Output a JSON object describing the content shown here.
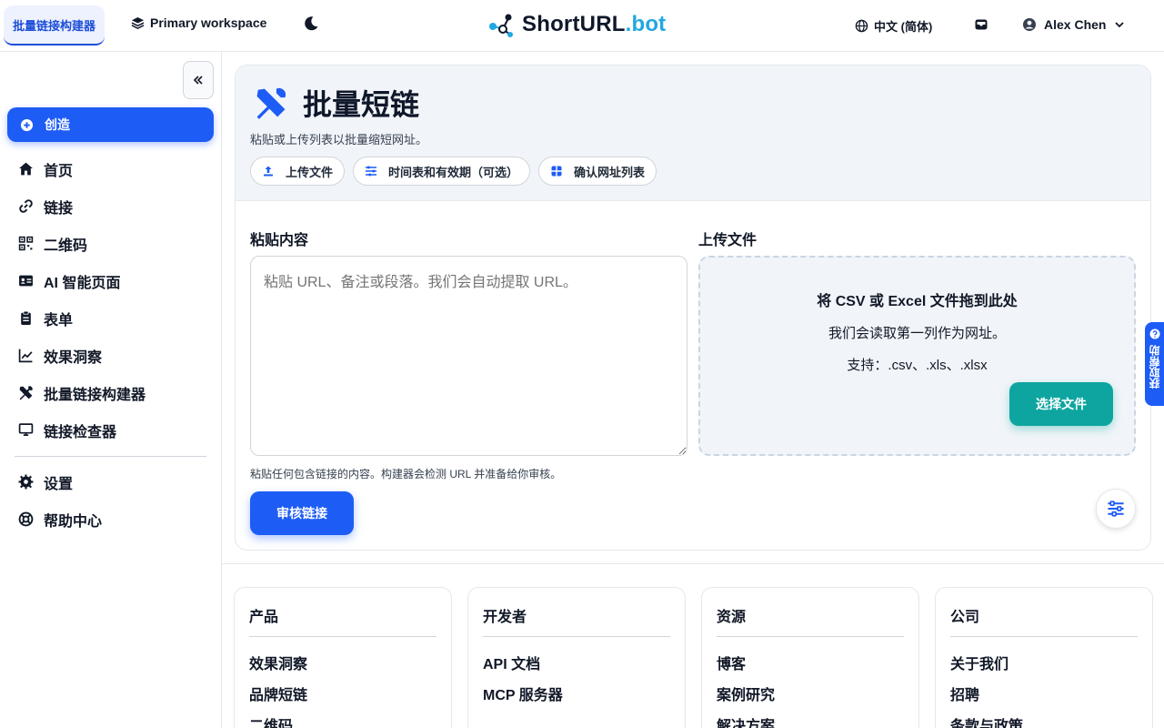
{
  "header": {
    "active_tab": "批量链接构建器",
    "workspace": "Primary workspace",
    "brand_prefix": "ShortURL",
    "brand_suffix": ".bot",
    "language": "中文 (简体)",
    "user_name": "Alex Chen"
  },
  "sidebar": {
    "create_label": "创造",
    "items": [
      {
        "label": "首页",
        "icon": "home-icon"
      },
      {
        "label": "链接",
        "icon": "link-icon"
      },
      {
        "label": "二维码",
        "icon": "qr-code-icon"
      },
      {
        "label": "AI 智能页面",
        "icon": "id-card-icon"
      },
      {
        "label": "表单",
        "icon": "clipboard-icon"
      },
      {
        "label": "效果洞察",
        "icon": "chart-line-icon"
      },
      {
        "label": "批量链接构建器",
        "icon": "tools-icon"
      },
      {
        "label": "链接检查器",
        "icon": "monitor-icon"
      }
    ],
    "secondary": [
      {
        "label": "设置",
        "icon": "gear-icon"
      },
      {
        "label": "帮助中心",
        "icon": "lifebuoy-icon"
      }
    ]
  },
  "main": {
    "title": "批量短链",
    "subtitle": "粘贴或上传列表以批量缩短网址。",
    "chips": [
      "上传文件",
      "时间表和有效期（可选）",
      "确认网址列表"
    ],
    "paste": {
      "label": "粘贴内容",
      "placeholder": "粘贴 URL、备注或段落。我们会自动提取 URL。",
      "hint": "粘贴任何包含链接的内容。构建器会检测 URL 并准备给你审核。",
      "review_button": "审核链接"
    },
    "upload": {
      "label": "上传文件",
      "drop_title": "将 CSV 或 Excel 文件拖到此处",
      "drop_desc": "我们会读取第一列作为网址。",
      "supported": "支持：.csv、.xls、.xlsx",
      "choose_button": "选择文件"
    }
  },
  "help_tab": "获取帮助",
  "footer": {
    "columns": [
      {
        "title": "产品",
        "links": [
          "效果洞察",
          "品牌短链",
          "二维码"
        ]
      },
      {
        "title": "开发者",
        "links": [
          "API 文档",
          "MCP 服务器"
        ]
      },
      {
        "title": "资源",
        "links": [
          "博客",
          "案例研究",
          "解决方案"
        ]
      },
      {
        "title": "公司",
        "links": [
          "关于我们",
          "招聘",
          "条款与政策"
        ]
      }
    ]
  },
  "colors": {
    "primary": "#1d5cf5",
    "teal": "#0ea5a0",
    "brand_accent": "#22a7e0"
  }
}
